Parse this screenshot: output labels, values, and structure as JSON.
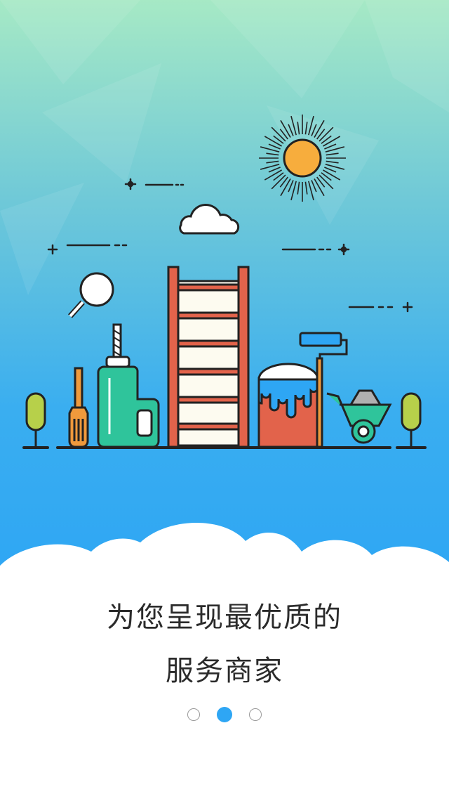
{
  "onboarding": {
    "headline_line1": "为您呈现最优质的",
    "headline_line2": "服务商家",
    "page_count": 3,
    "active_page_index": 1
  },
  "colors": {
    "sky_top": "#a6e9c5",
    "sky_bottom": "#2ea6f4",
    "dot_active": "#2ea6f4",
    "sun": "#f7ad3d",
    "ladder": "#e2634b",
    "bottle": "#2fc49b",
    "paint_bucket": "#e2634b"
  },
  "illustration": {
    "icons": [
      "sun-icon",
      "cloud-icon",
      "magnifier-icon",
      "screwdriver-icon",
      "drill-icon",
      "ladder-icon",
      "paint-bucket-icon",
      "paint-roller-icon",
      "wheelbarrow-icon",
      "tree-icon"
    ]
  }
}
